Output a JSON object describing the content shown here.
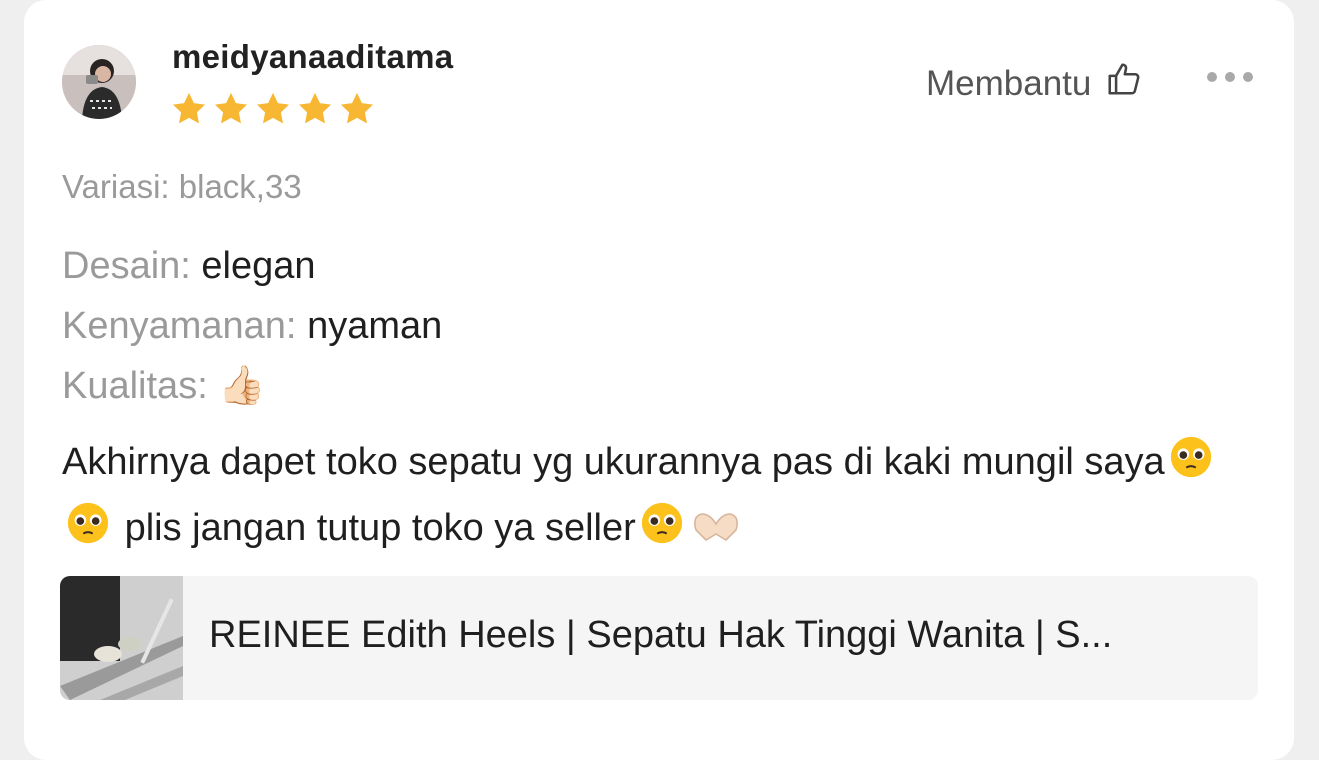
{
  "review": {
    "username": "meidyanaaditama",
    "rating": 5,
    "helpful_label": "Membantu",
    "variation": "Variasi: black,33",
    "attributes": [
      {
        "key": "Desain:",
        "value": "elegan"
      },
      {
        "key": "Kenyamanan:",
        "value": "nyaman"
      },
      {
        "key": "Kualitas:",
        "value": "👍🏻"
      }
    ],
    "comment_part1": "Akhirnya dapet toko sepatu yg ukurannya pas di kaki mungil saya",
    "comment_part2": "plis jangan tutup toko ya seller",
    "product_name": "REINEE Edith Heels | Sepatu Hak Tinggi Wanita | S..."
  },
  "icons": {
    "helpful": "thumbs-up-outline-icon",
    "more": "more-horizontal-icon",
    "star": "star-filled-icon",
    "pleading": "pleading-face-emoji",
    "heart_hands": "heart-hands-emoji"
  },
  "colors": {
    "star": "#f7b733",
    "muted_text": "#9a9a9a",
    "body_text": "#1f1f1f"
  }
}
